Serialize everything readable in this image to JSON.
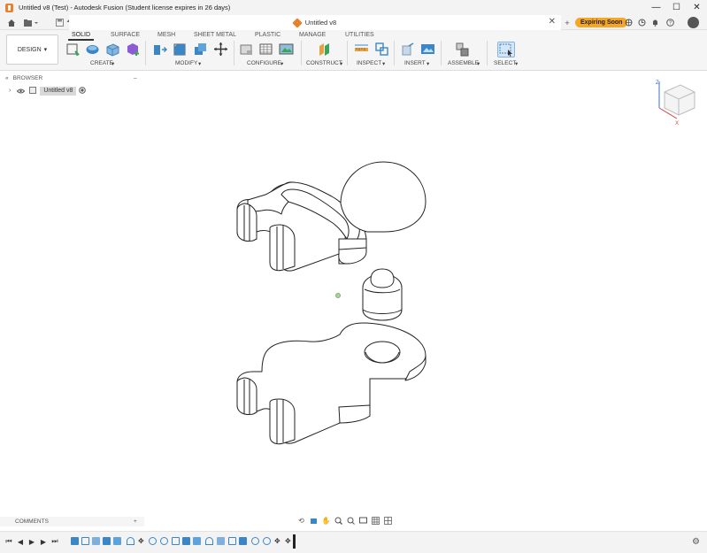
{
  "window": {
    "title": "Untitled v8 (Test) - Autodesk Fusion (Student license expires in 26 days)",
    "controls": [
      "—",
      "☐",
      "✕"
    ]
  },
  "tabbar": {
    "document_tab": "Untitled v8",
    "expiring_badge": "Expiring Soon"
  },
  "toolbar": {
    "workspace": "DESIGN",
    "workspace_caret": "▾",
    "categories": [
      "SOLID",
      "SURFACE",
      "MESH",
      "SHEET METAL",
      "PLASTIC",
      "MANAGE",
      "UTILITIES"
    ],
    "active_category": "SOLID",
    "groups": [
      "CREATE",
      "MODIFY",
      "CONFIGURE",
      "CONSTRUCT",
      "INSPECT",
      "INSERT",
      "ASSEMBLE",
      "SELECT"
    ]
  },
  "browser": {
    "title": "BROWSER",
    "root_item": "Untitled v8"
  },
  "comments": {
    "title": "COMMENTS",
    "add_label": "+"
  },
  "colors": {
    "accent": "#e8812d",
    "expiring": "#f5a623",
    "icon_blue": "#3d86c6",
    "icon_purple": "#8d5bd6",
    "icon_green": "#3aa55a",
    "icon_orange": "#e8a040"
  }
}
